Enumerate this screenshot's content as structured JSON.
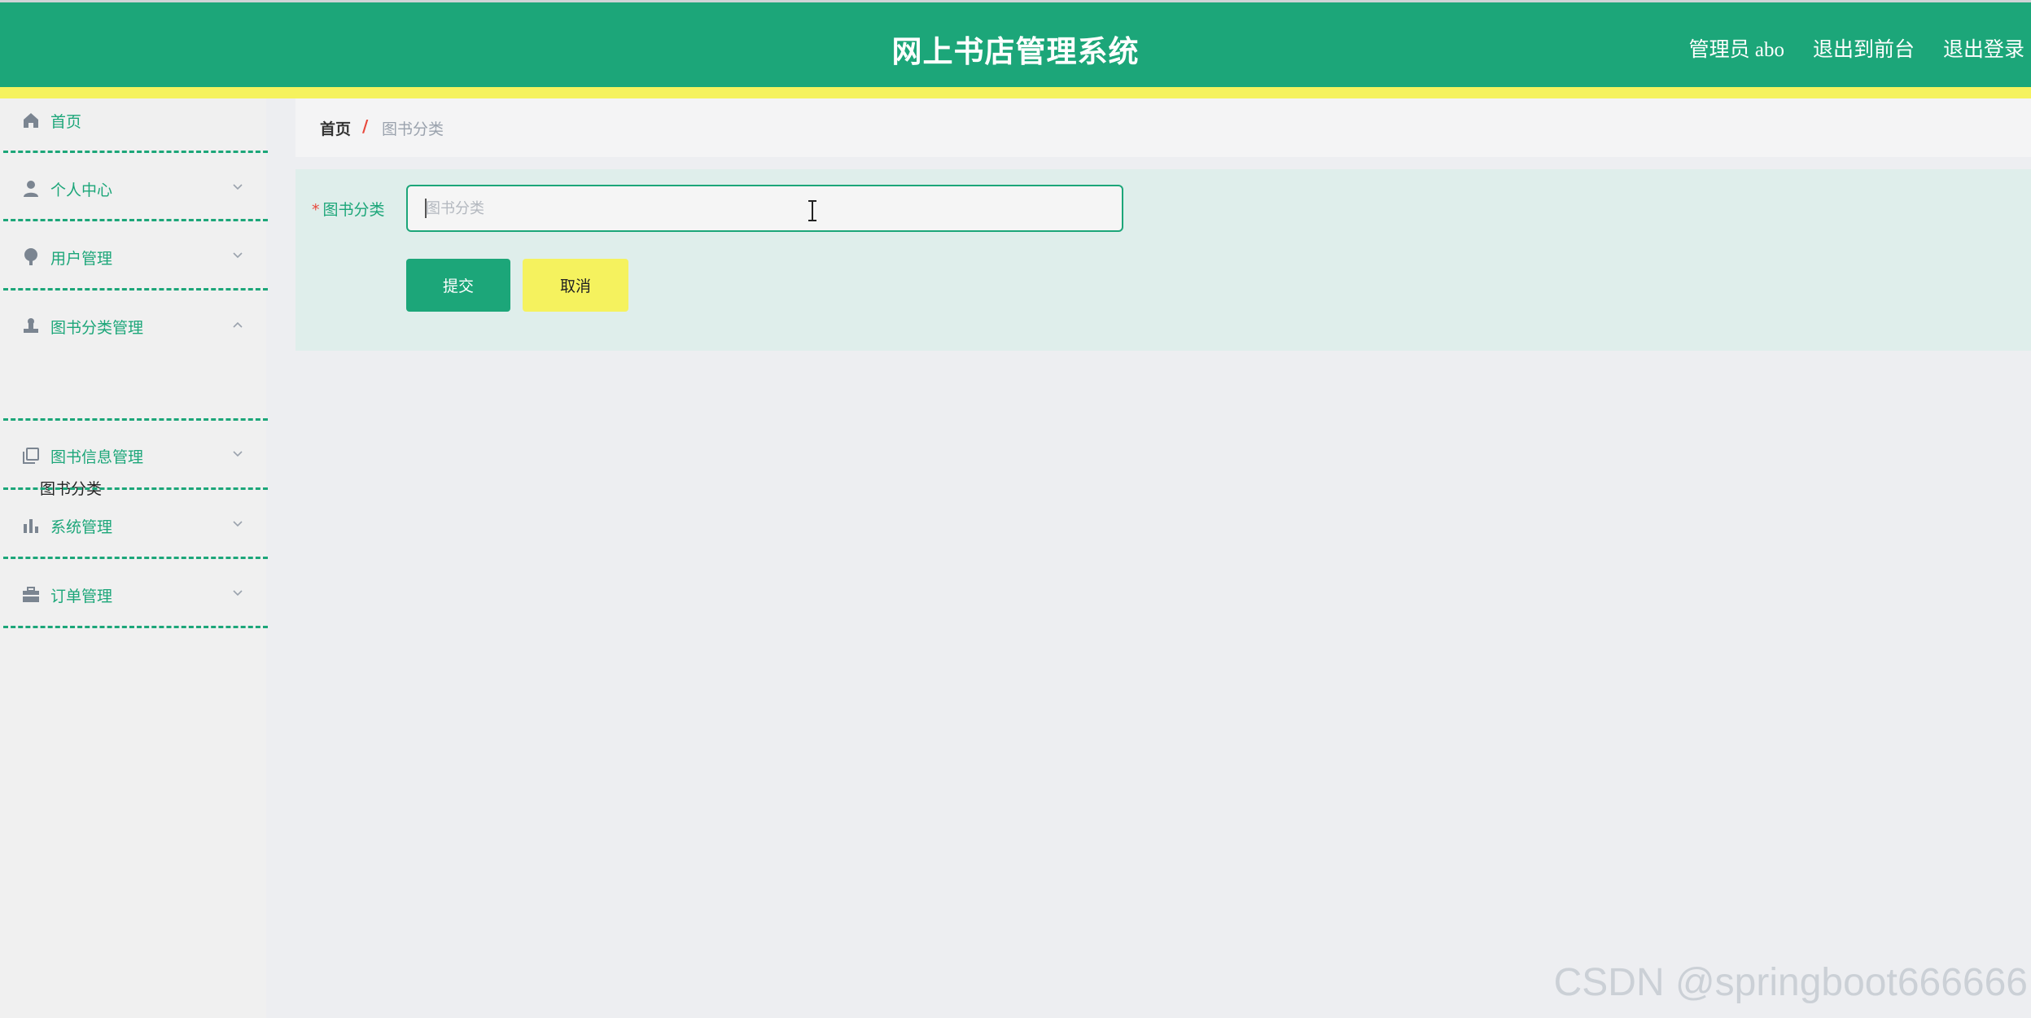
{
  "header": {
    "title": "网上书店管理系统",
    "admin_label": "管理员 abo",
    "to_front_label": "退出到前台",
    "logout_label": "退出登录"
  },
  "sidebar": {
    "items": [
      {
        "label": "首页",
        "icon": "home-icon"
      },
      {
        "label": "个人中心",
        "icon": "user-icon"
      },
      {
        "label": "用户管理",
        "icon": "pin-icon"
      },
      {
        "label": "图书分类管理",
        "icon": "stamp-icon",
        "expanded": true,
        "children": [
          "图书分类"
        ]
      },
      {
        "label": "图书信息管理",
        "icon": "copy-icon"
      },
      {
        "label": "系统管理",
        "icon": "bar-chart-icon"
      },
      {
        "label": "订单管理",
        "icon": "briefcase-icon"
      }
    ]
  },
  "breadcrumb": {
    "home": "首页",
    "separator": "/",
    "current": "图书分类"
  },
  "form": {
    "field_label": "图书分类",
    "required_mark": "*",
    "field_value": "",
    "field_placeholder": "图书分类",
    "submit_label": "提交",
    "cancel_label": "取消"
  },
  "watermark": "CSDN @springboot666666",
  "colors": {
    "primary": "#1ca679",
    "accent_yellow": "#f5f25e",
    "breadcrumb_separator": "#e8483c"
  }
}
